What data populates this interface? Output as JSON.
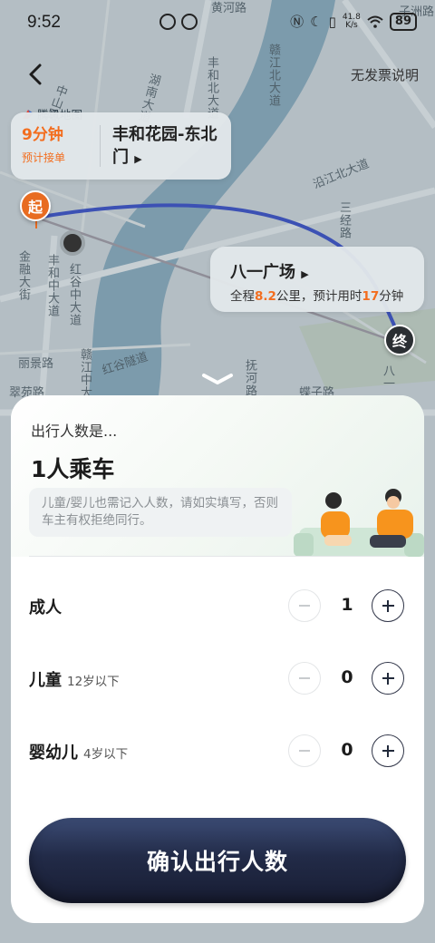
{
  "status_bar": {
    "time": "9:52",
    "network_speed_value": "41.8",
    "network_speed_unit": "K/s",
    "battery": "89",
    "icons": [
      "nfc-icon",
      "moon-icon",
      "vibrate-icon",
      "wifi-icon",
      "battery-icon"
    ]
  },
  "nav": {
    "back_icon": "chevron-left-icon",
    "no_invoice_label": "无发票说明"
  },
  "map": {
    "provider_label": "騰讯地图",
    "streets": {
      "huanghe_road": "黄河路",
      "fenghe_north_ave": "丰和北大道",
      "ganjiang_north_ave": "赣江北大道",
      "hunan_ave": "湖南大道",
      "zhongshan_road": "中山路",
      "yanjiang_north_ave": "沿江北大道",
      "sanjing_road": "三经路",
      "jinsheng_ave": "金融大街",
      "fenghe_middle_ave": "丰和中大道",
      "honggu_middle_ave": "红谷中大道",
      "lijing_road": "丽景路",
      "ganjiang_middle_ave": "赣江中大道",
      "honggu_tunnel": "红谷隧道",
      "cuiyuan_road": "翠苑路",
      "fuhe_road": "抚河路",
      "diezi_road": "蝶子路",
      "bayi_street_right": "八一",
      "road_top_right": "子洲路"
    },
    "start_marker": "起",
    "end_marker": "终"
  },
  "pickup_card": {
    "eta": "9分钟",
    "eta_label": "预计接单",
    "location": "丰和花园-东北门",
    "chevron_icon": "triangle-right-icon"
  },
  "destination_card": {
    "name": "八一广场",
    "prefix": "全程",
    "distance": "8.2",
    "distance_unit": "公里，预计用时",
    "duration": "17",
    "duration_unit": "分钟",
    "chevron_icon": "triangle-right-icon"
  },
  "sheet": {
    "collapse_icon": "chevron-down-icon",
    "subtitle": "出行人数是...",
    "title": "1人乘车",
    "notice": "儿童/婴儿也需记入人数，请如实填写，否则车主有权拒绝同行。",
    "illustration": "passengers-on-sofa-illustration",
    "rows": [
      {
        "label": "成人",
        "age": "",
        "value": "1"
      },
      {
        "label": "儿童",
        "age": "12岁以下",
        "value": "0"
      },
      {
        "label": "婴幼儿",
        "age": "4岁以下",
        "value": "0"
      }
    ],
    "confirm_label": "确认出行人数"
  },
  "colors": {
    "accent_orange": "#f36d1e",
    "route_blue": "#3c51b4",
    "confirm_dark": "#222b48",
    "river": "#7c9bac"
  }
}
